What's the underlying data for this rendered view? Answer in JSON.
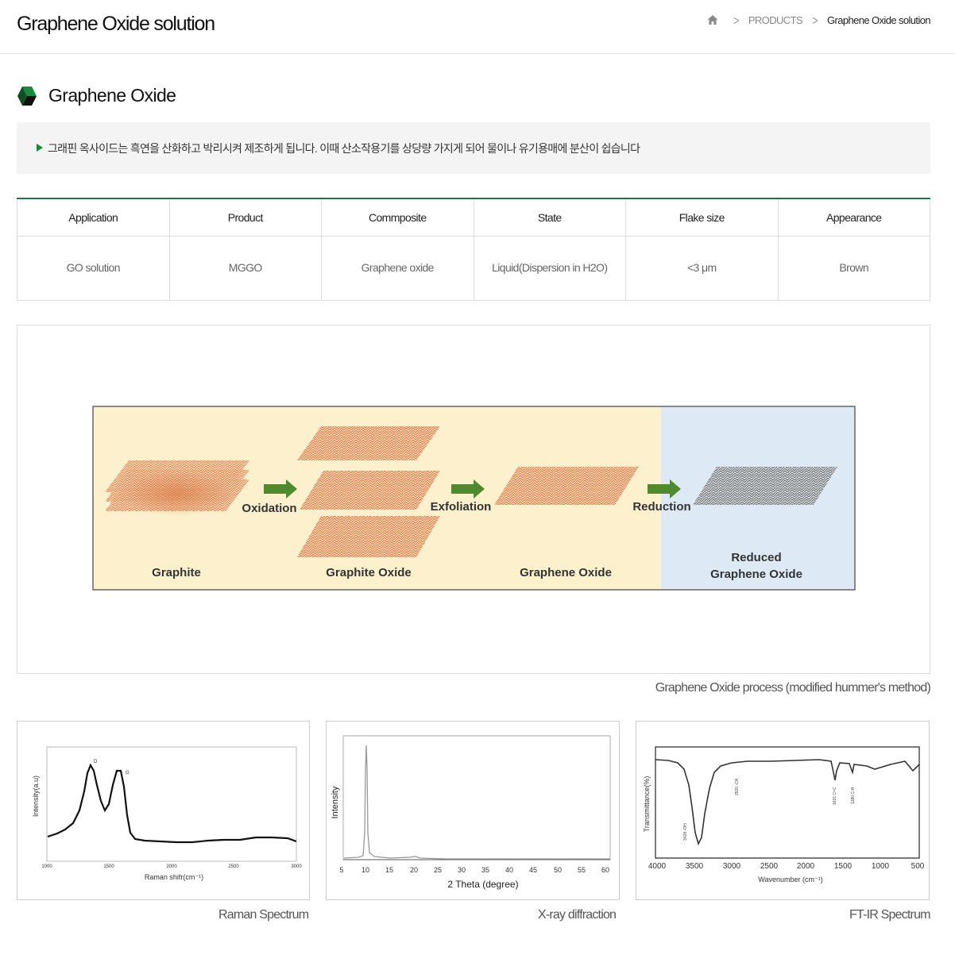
{
  "header": {
    "title": "Graphene Oxide solution",
    "breadcrumb": {
      "home_icon": "home-icon",
      "items": [
        "PRODUCTS",
        "Graphene Oxide solution"
      ]
    }
  },
  "section": {
    "icon": "hexagon-cube-icon",
    "title": "Graphene Oxide"
  },
  "intro": "그래핀 옥사이드는 흑연을 산화하고 박리시켜 제조하게 됩니다. 이때 산소작용기를 상당량 가지게 되어 물이나 유기용매에 분산이 쉽습니다",
  "table": {
    "headers": [
      "Application",
      "Product",
      "Commposite",
      "State",
      "Flake size",
      "Appearance"
    ],
    "row": [
      "GO solution",
      "MGGO",
      "Graphene oxide",
      "Liquid(Dispersion in H2O)",
      "<3 μm",
      "Brown"
    ]
  },
  "process": {
    "caption": "Graphene Oxide process (modified hummer's method)",
    "steps": [
      "Oxidation",
      "Exfoliation",
      "Reduction"
    ],
    "labels": [
      "Graphite",
      "Graphite Oxide",
      "Graphene Oxide",
      "Reduced",
      "Graphene Oxide"
    ],
    "colors": {
      "warm_bg": "#fdf0cd",
      "cool_bg": "#dde9f5",
      "arrow": "#4f8a2e",
      "sheet": "#e39a68",
      "reduced_sheet": "#7b7b7b"
    }
  },
  "spectra": {
    "raman": {
      "caption": "Raman Spectrum",
      "ylabel": "Intensity(a.u)",
      "xlabel": "Raman shifr(cm⁻¹)",
      "ticks": [
        "1000",
        "1500",
        "2000",
        "2500",
        "3000"
      ],
      "peaks": [
        "D",
        "G"
      ]
    },
    "xrd": {
      "caption": "X-ray diffraction",
      "ylabel": "Intensity",
      "xlabel": "2 Theta (degree)",
      "ticks": [
        "5",
        "10",
        "15",
        "20",
        "25",
        "30",
        "35",
        "40",
        "45",
        "50",
        "55",
        "60"
      ]
    },
    "ftir": {
      "caption": "FT-IR Spectrum",
      "ylabel": "Transmittance(%)",
      "xlabel": "Wavenumber (cm⁻¹)",
      "ticks": [
        "4000",
        "3500",
        "3000",
        "2500",
        "2000",
        "1500",
        "1000",
        "500"
      ],
      "peak_labels": [
        "3428 -OH",
        "2920 -CH",
        "1631 C=C",
        "1380 C-H"
      ]
    }
  }
}
